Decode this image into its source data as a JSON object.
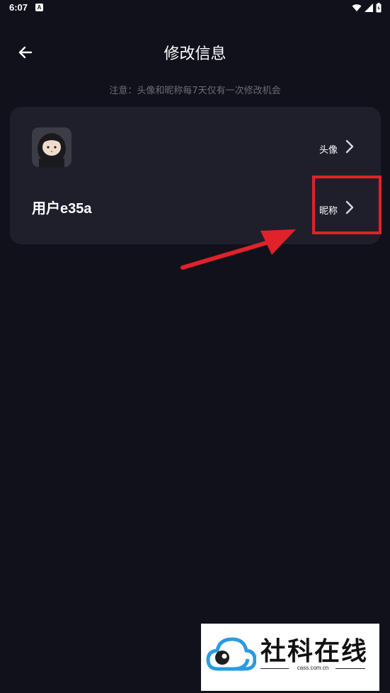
{
  "status_bar": {
    "time": "6:07",
    "app_icon_letter": "A"
  },
  "header": {
    "title": "修改信息",
    "back_icon": "arrow-left-icon"
  },
  "notice": "注意：头像和昵称每7天仅有一次修改机会",
  "card": {
    "avatar_row_label": "头像",
    "nickname_row_label": "昵称",
    "username": "用户e35a"
  },
  "annotation": {
    "highlight_color": "#e02229"
  },
  "watermark": {
    "title": "社科在线",
    "domain": "cass.com.cn"
  }
}
